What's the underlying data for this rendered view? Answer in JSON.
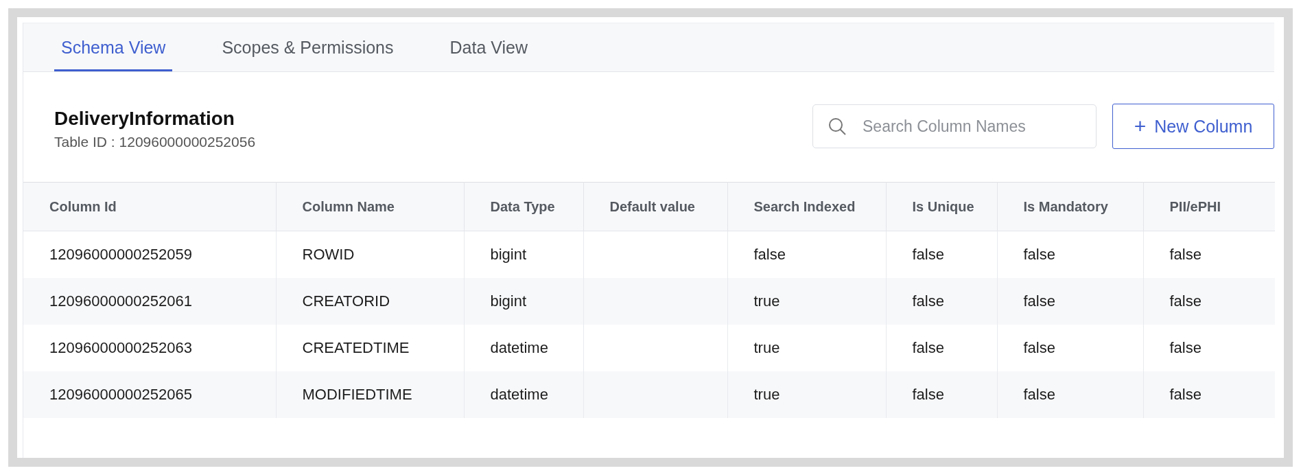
{
  "tabs": [
    {
      "label": "Schema View",
      "selected": true
    },
    {
      "label": "Scopes & Permissions",
      "selected": false
    },
    {
      "label": "Data View",
      "selected": false
    }
  ],
  "header": {
    "title": "DeliveryInformation",
    "subtitle": "Table ID : 12096000000252056"
  },
  "search": {
    "placeholder": "Search Column Names"
  },
  "new_button": {
    "icon": "+",
    "label": "New Column"
  },
  "table": {
    "columns": [
      "Column Id",
      "Column Name",
      "Data Type",
      "Default value",
      "Search Indexed",
      "Is Unique",
      "Is Mandatory",
      "PII/ePHI"
    ],
    "rows": [
      [
        "12096000000252059",
        "ROWID",
        "bigint",
        "",
        "false",
        "false",
        "false",
        "false"
      ],
      [
        "12096000000252061",
        "CREATORID",
        "bigint",
        "",
        "true",
        "false",
        "false",
        "false"
      ],
      [
        "12096000000252063",
        "CREATEDTIME",
        "datetime",
        "",
        "true",
        "false",
        "false",
        "false"
      ],
      [
        "12096000000252065",
        "MODIFIEDTIME",
        "datetime",
        "",
        "true",
        "false",
        "false",
        "false"
      ]
    ]
  }
}
